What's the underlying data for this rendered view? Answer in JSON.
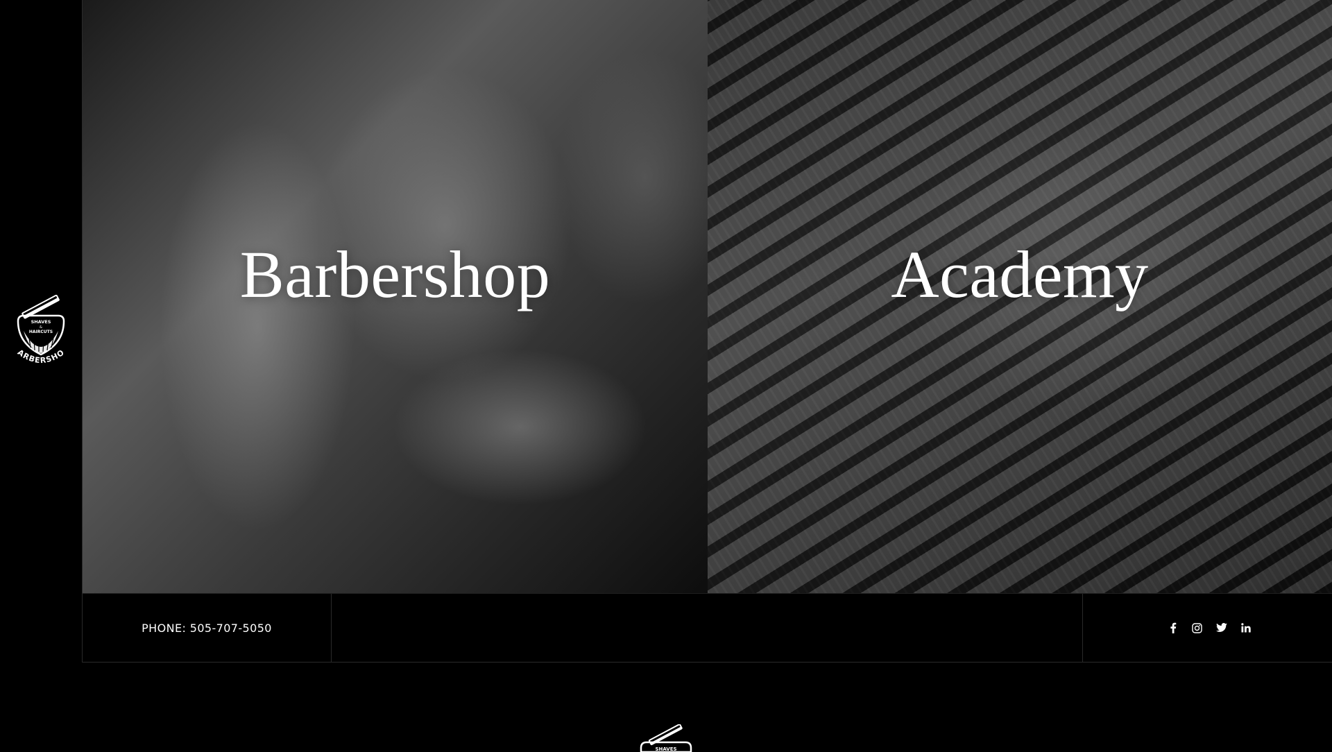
{
  "logo": {
    "line1": "SHAVES",
    "line2": "&",
    "line3": "HAIRCUTS",
    "brand": "BARBERSHOP",
    "icon": "razor-beard-logo"
  },
  "panels": [
    {
      "title": "Barbershop",
      "image": "barber-shaving-photo"
    },
    {
      "title": "Academy",
      "image": "hair-clippers-photo"
    }
  ],
  "infobar": {
    "phone": "PHONE: 505-707-5050"
  },
  "social": [
    {
      "name": "facebook",
      "icon": "facebook-icon"
    },
    {
      "name": "instagram",
      "icon": "instagram-icon"
    },
    {
      "name": "twitter",
      "icon": "twitter-icon"
    },
    {
      "name": "linkedin",
      "icon": "linkedin-icon"
    }
  ],
  "footer": {
    "logo_text": "SHAVES"
  },
  "colors": {
    "background": "#000000",
    "text": "#ffffff",
    "divider": "#2a2a2a"
  }
}
